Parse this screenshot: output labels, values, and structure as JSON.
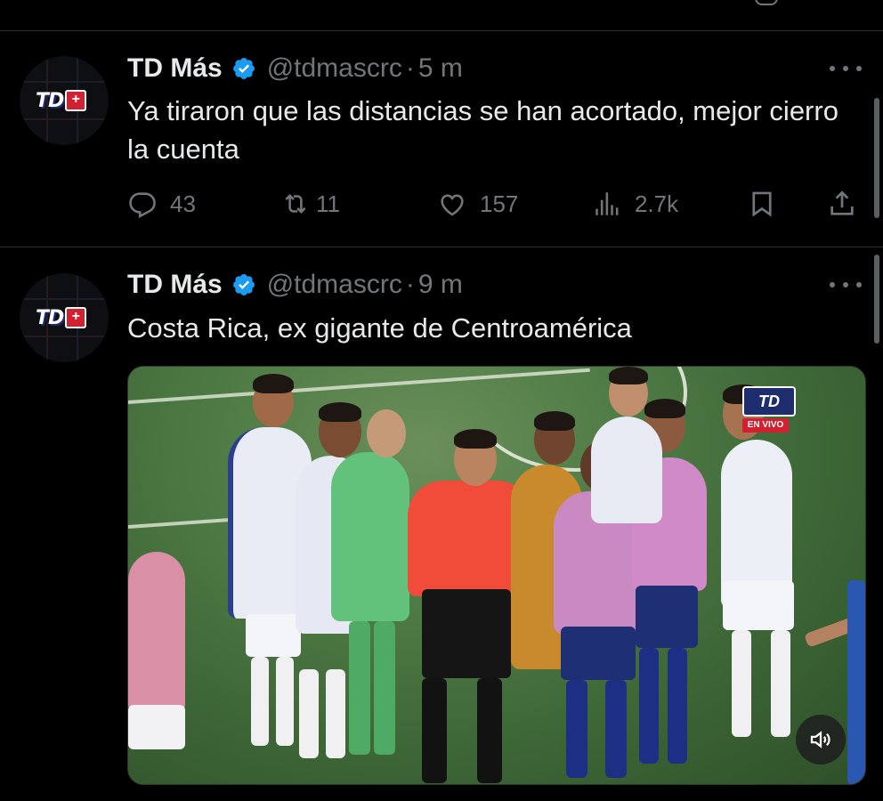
{
  "tweets": [
    {
      "display_name": "TD Más",
      "handle": "@tdmascrc",
      "separator": "·",
      "time": "5 m",
      "text": "Ya tiraron que las distancias se han acortado, mejor cierro la cuenta",
      "avatar_logo": "TD",
      "metrics": {
        "replies": "43",
        "reposts": "11",
        "likes": "157",
        "views": "2.7k"
      }
    },
    {
      "display_name": "TD Más",
      "handle": "@tdmascrc",
      "separator": "·",
      "time": "9 m",
      "text": "Costa Rica, ex gigante de Centroamérica",
      "avatar_logo": "TD",
      "media": {
        "badge_logo": "TD",
        "badge_live": "EN VIVO"
      }
    }
  ],
  "icons": {
    "verified": "verified-badge-icon",
    "more": "more-options-icon",
    "reply": "reply-icon",
    "repost": "repost-icon",
    "like": "heart-icon",
    "views": "analytics-icon",
    "bookmark": "bookmark-icon",
    "share": "share-icon",
    "sound": "speaker-icon"
  },
  "colors": {
    "background": "#000000",
    "text": "#e7e9ea",
    "muted": "#71767b",
    "verified_blue": "#1d9bf0",
    "divider": "#2f3336"
  }
}
